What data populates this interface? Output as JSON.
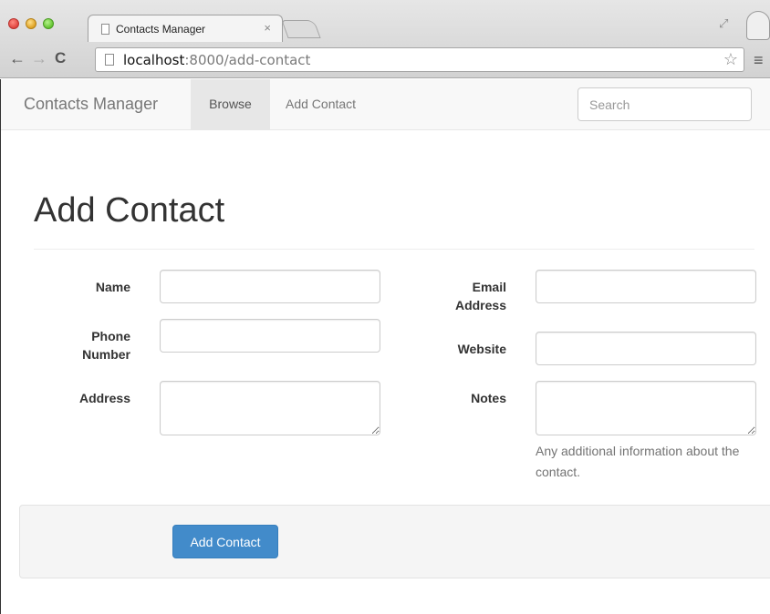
{
  "browser": {
    "tab_title": "Contacts Manager",
    "tab_close": "×",
    "url_host": "localhost",
    "url_path": ":8000/add-contact",
    "back_icon": "←",
    "forward_icon": "→",
    "reload_icon": "C",
    "star_icon": "☆",
    "menu_icon": "≡",
    "expand_icon": "⤢"
  },
  "navbar": {
    "brand": "Contacts Manager",
    "links": [
      {
        "label": "Browse",
        "active": true
      },
      {
        "label": "Add Contact",
        "active": false
      }
    ],
    "search_placeholder": "Search"
  },
  "page": {
    "title": "Add Contact"
  },
  "form": {
    "name": {
      "label": "Name",
      "value": ""
    },
    "phone": {
      "label_line1": "Phone",
      "label_line2": "Number",
      "value": ""
    },
    "address": {
      "label": "Address",
      "value": ""
    },
    "email": {
      "label_line1": "Email",
      "label_line2": "Address",
      "value": ""
    },
    "website": {
      "label": "Website",
      "value": ""
    },
    "notes": {
      "label": "Notes",
      "value": "",
      "help": "Any additional information about the contact."
    },
    "submit_label": "Add Contact"
  },
  "colors": {
    "primary": "#428bca",
    "navbar_bg": "#f8f8f8",
    "active_nav_bg": "#e7e7e7"
  }
}
